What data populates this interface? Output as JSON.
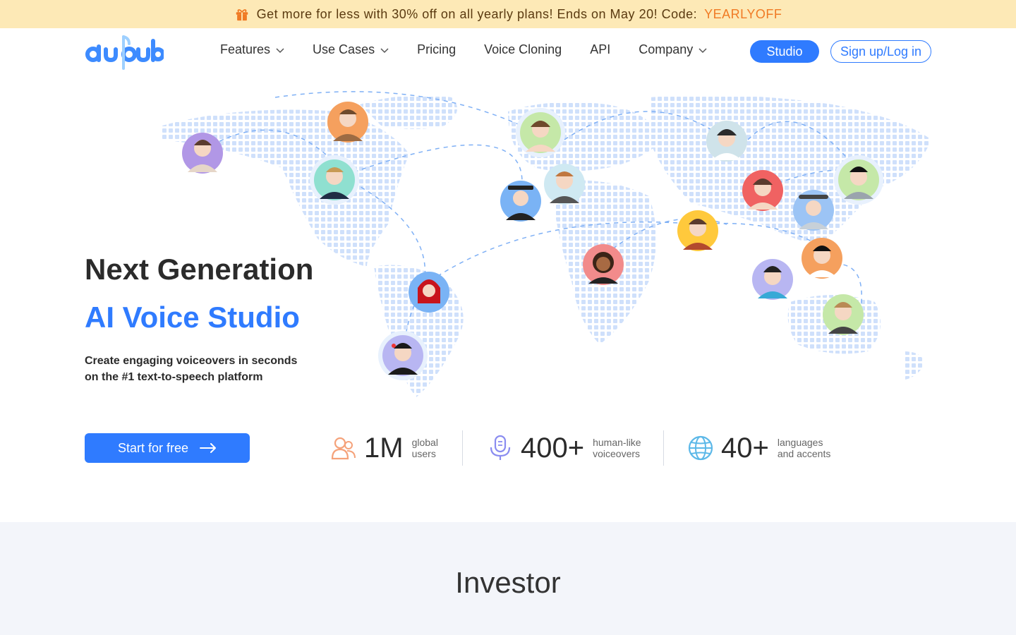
{
  "promo": {
    "text": "Get more for less with 30% off on all yearly plans! Ends on May 20! Code:",
    "code": "YEARLYOFF"
  },
  "header": {
    "logo_text": "dubdub",
    "nav": [
      {
        "label": "Features",
        "has_dropdown": true
      },
      {
        "label": "Use Cases",
        "has_dropdown": true
      },
      {
        "label": "Pricing",
        "has_dropdown": false
      },
      {
        "label": "Voice Cloning",
        "has_dropdown": false
      },
      {
        "label": "API",
        "has_dropdown": false
      },
      {
        "label": "Company",
        "has_dropdown": true
      }
    ],
    "studio_label": "Studio",
    "login_label": "Sign up/Log in"
  },
  "hero": {
    "title": "Next Generation",
    "subtitle": "AI Voice Studio",
    "desc_line1": "Create engaging voiceovers in seconds",
    "desc_line2": "on the #1 text-to-speech platform",
    "cta_label": "Start for free"
  },
  "stats": [
    {
      "icon": "users-icon",
      "value": "1M",
      "label_line1": "global",
      "label_line2": "users"
    },
    {
      "icon": "microphone-icon",
      "value": "400+",
      "label_line1": "human-like",
      "label_line2": "voiceovers"
    },
    {
      "icon": "globe-icon",
      "value": "40+",
      "label_line1": "languages",
      "label_line2": "and accents"
    }
  ],
  "investor": {
    "title": "Investor"
  },
  "colors": {
    "accent": "#2f7bff",
    "promo_bg": "#fde9b6",
    "promo_code": "#f07a24",
    "section_bg": "#f3f5fa"
  }
}
